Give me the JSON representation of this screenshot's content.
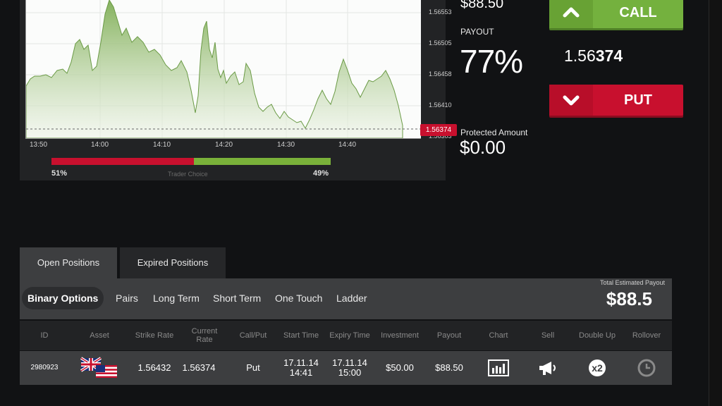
{
  "chart": {
    "y_ticks": [
      "1.56553",
      "1.56505",
      "1.56458",
      "1.56410",
      "1.56363"
    ],
    "current_price": "1.56374",
    "x_ticks": [
      "13:50",
      "14:00",
      "14:10",
      "14:20",
      "14:30",
      "14:40"
    ],
    "sentiment": {
      "put_pct": "51%",
      "call_pct": "49%",
      "label": "Trader Choice",
      "put_fraction": 0.51
    },
    "colors": {
      "put": "#c8102e",
      "call": "#7ab13a"
    }
  },
  "trade": {
    "amount": "$88.50",
    "payout_label": "PAYOUT",
    "payout": "77%",
    "protected_label": "Protected Amount",
    "protected_value": "$0.00",
    "call_label": "CALL",
    "put_label": "PUT",
    "rate_prefix": "1.56",
    "rate_bold": "374"
  },
  "tabs": {
    "open": "Open Positions",
    "expired": "Expired Positions"
  },
  "filters": [
    "Binary Options",
    "Pairs",
    "Long Term",
    "Short Term",
    "One Touch",
    "Ladder"
  ],
  "total": {
    "label": "Total Estimated Payout",
    "value": "$88.5"
  },
  "table": {
    "headers": [
      "ID",
      "Asset",
      "Strike Rate",
      "Current Rate",
      "Call/Put",
      "Start Time",
      "Expiry Time",
      "Investment",
      "Payout",
      "Chart",
      "Sell",
      "Double Up",
      "Rollover"
    ],
    "row": {
      "id": "2980923",
      "asset_icon": "gbp-usd-flags-icon",
      "strike": "1.56432",
      "current": "1.56374",
      "callput": "Put",
      "start_date": "17.11.14",
      "start_time": "14:41",
      "expiry_date": "17.11.14",
      "expiry_time": "15:00",
      "investment": "$50.00",
      "payout": "$88.50"
    }
  }
}
